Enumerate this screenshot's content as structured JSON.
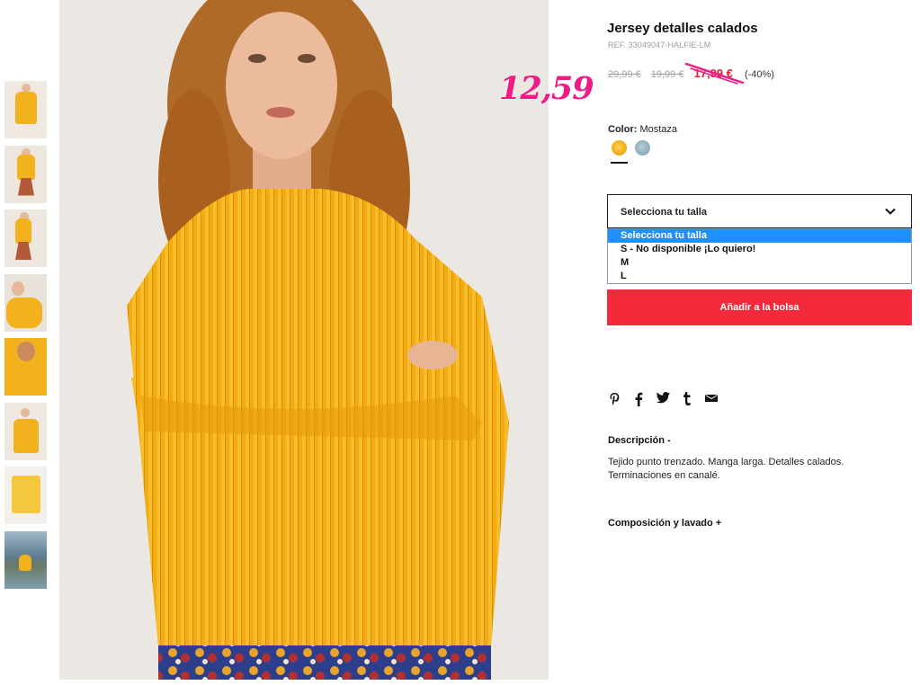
{
  "product": {
    "title": "Jersey detalles calados",
    "ref": "REF. 33049047-HALFIE-LM",
    "prices": {
      "original": "29,99 €",
      "previous": "19,99 €",
      "current": "17,99 €",
      "discount": "(-40%)"
    },
    "handwritten_price": "12,59",
    "color": {
      "label": "Color:",
      "value": "Mostaza",
      "swatches": [
        "mustard",
        "blue-grey"
      ],
      "colors": {
        "mustard": "#f0ad1a",
        "blue_grey": "#8fb0bd"
      }
    }
  },
  "size_select": {
    "label": "Selecciona tu talla",
    "options": [
      "Selecciona tu talla",
      "S - No disponible ¡Lo quiero!",
      "M",
      "L"
    ],
    "selected_index": 0
  },
  "add_to_bag": {
    "label": "Añadir a la bolsa",
    "color": "#f22a3c"
  },
  "share_icons": [
    "pinterest-icon",
    "facebook-icon",
    "twitter-icon",
    "tumblr-icon",
    "email-icon"
  ],
  "description": {
    "title": "Descripción -",
    "text": "Tejido punto trenzado. Manga larga. Detalles calados. Terminaciones en canalé."
  },
  "composition": {
    "title": "Composición y lavado +"
  },
  "thumbnails": [
    "front",
    "full-body",
    "full-body-side",
    "sleeve-detail",
    "close-up",
    "front-crop",
    "flat-lay",
    "outdoor"
  ],
  "colors": {
    "accent": "#f22a3c",
    "sale_red": "#e2232e",
    "annotation_pink": "#ee1a86",
    "select_highlight": "#1e90ff"
  }
}
